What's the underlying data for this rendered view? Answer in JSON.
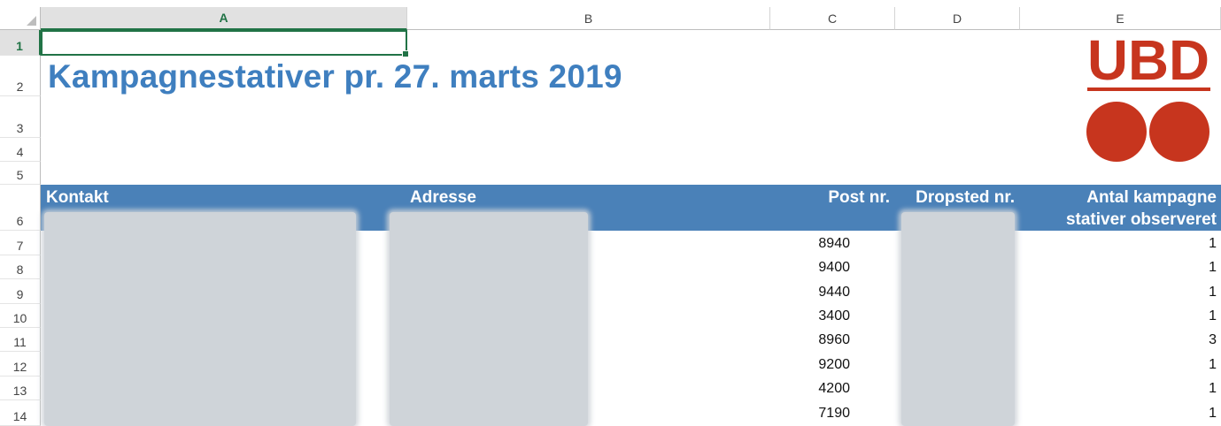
{
  "columns": [
    "A",
    "B",
    "C",
    "D",
    "E"
  ],
  "rows": [
    "1",
    "2",
    "3",
    "4",
    "5",
    "6",
    "7",
    "8",
    "9",
    "10",
    "11",
    "12",
    "13",
    "14"
  ],
  "title": "Kampagnestativer pr. 27. marts 2019",
  "logo": {
    "text": "UBD",
    "color": "#c7351e"
  },
  "table_headers": {
    "kontakt": "Kontakt",
    "adresse": "Adresse",
    "post_nr": "Post nr.",
    "dropsted_nr": "Dropsted nr.",
    "antal_line1": "Antal kampagne",
    "antal_line2": "stativer observeret"
  },
  "data_rows": [
    {
      "post": "8940",
      "antal": "1"
    },
    {
      "post": "9400",
      "antal": "1"
    },
    {
      "post": "9440",
      "antal": "1"
    },
    {
      "post": "3400",
      "antal": "1"
    },
    {
      "post": "8960",
      "antal": "3"
    },
    {
      "post": "9200",
      "antal": "1"
    },
    {
      "post": "4200",
      "antal": "1"
    },
    {
      "post": "7190",
      "antal": "1"
    }
  ],
  "colors": {
    "header_band": "#4a81b8",
    "title": "#3f7fbf",
    "selection": "#217346"
  }
}
